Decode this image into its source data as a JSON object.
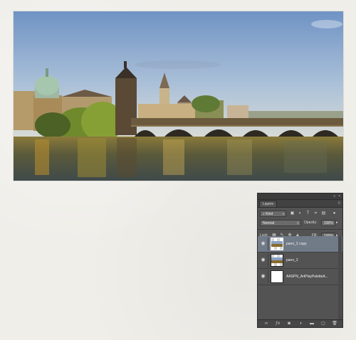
{
  "photo": {
    "subject": "Charles Bridge, Prague"
  },
  "panel": {
    "tab_label": "Layers",
    "filter": {
      "value": "Kind"
    },
    "blend_mode": {
      "value": "Normal"
    },
    "opacity": {
      "label": "Opacity:",
      "value": "100%"
    },
    "lock": {
      "label": "Lock:"
    },
    "fill": {
      "label": "Fill:",
      "value": "100%"
    },
    "layers": [
      {
        "name": "pano_2 copy",
        "selected": true,
        "visible": true
      },
      {
        "name": "pano_2",
        "selected": false,
        "visible": true
      },
      {
        "name": "AASPN_ArtPlayPaletteA...",
        "selected": false,
        "visible": true
      }
    ]
  },
  "colors": {
    "selection": "#717a87",
    "panel_bg": "#535353",
    "paper": "#efeee9"
  }
}
